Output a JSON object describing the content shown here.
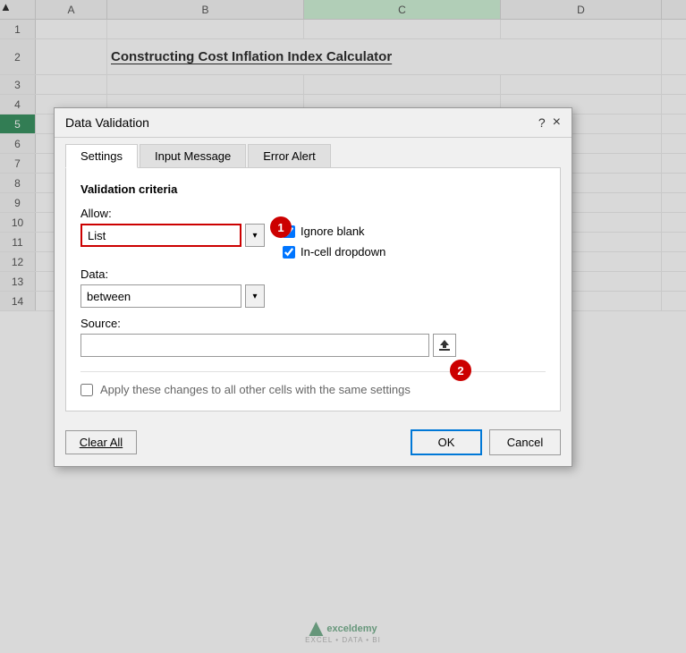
{
  "spreadsheet": {
    "columns": [
      "",
      "A",
      "B",
      "C",
      "D"
    ],
    "col_c_highlight": true,
    "title": "Constructing Cost Inflation Index Calculator",
    "rows": [
      "1",
      "2",
      "3",
      "4",
      "5",
      "6",
      "7",
      "8",
      "9",
      "10",
      "11",
      "12",
      "13",
      "14"
    ],
    "active_row": "5"
  },
  "dialog": {
    "title": "Data Validation",
    "help_label": "?",
    "close_label": "×",
    "tabs": [
      {
        "label": "Settings",
        "active": true
      },
      {
        "label": "Input Message",
        "active": false
      },
      {
        "label": "Error Alert",
        "active": false
      }
    ],
    "body": {
      "section_title": "Validation criteria",
      "allow_label": "Allow:",
      "allow_value": "List",
      "data_label": "Data:",
      "data_value": "between",
      "source_label": "Source:",
      "source_value": "",
      "ignore_blank_label": "Ignore blank",
      "ignore_blank_checked": true,
      "incell_dropdown_label": "In-cell dropdown",
      "incell_dropdown_checked": true,
      "apply_label": "Apply these changes to all other cells with the same settings",
      "apply_checked": false
    },
    "footer": {
      "clear_all_label": "Clear All",
      "ok_label": "OK",
      "cancel_label": "Cancel"
    },
    "badges": {
      "badge1": "1",
      "badge2": "2"
    }
  },
  "watermark": {
    "name": "exceldemy",
    "tagline": "EXCEL • DATA • BI"
  }
}
